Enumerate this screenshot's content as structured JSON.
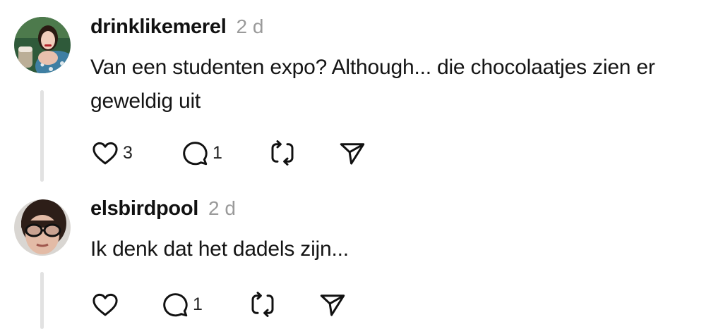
{
  "thread": [
    {
      "username": "drinklikemerel",
      "time": "2 d",
      "text": "Van een studenten expo? Although... die chocolaatjes zien er geweldig uit",
      "actions": {
        "like_count": "3",
        "reply_count": "1",
        "repost_count": "",
        "share_count": ""
      }
    },
    {
      "username": "elsbirdpool",
      "time": "2 d",
      "text": "Ik denk dat het dadels zijn...",
      "actions": {
        "like_count": "",
        "reply_count": "1",
        "repost_count": "",
        "share_count": ""
      }
    }
  ],
  "icons": {
    "like": "heart-icon",
    "reply": "comment-icon",
    "repost": "repost-icon",
    "share": "send-icon"
  },
  "colors": {
    "text": "#111111",
    "muted": "#9a9a9a",
    "thread_line": "#e2e2e2",
    "background": "#ffffff"
  }
}
